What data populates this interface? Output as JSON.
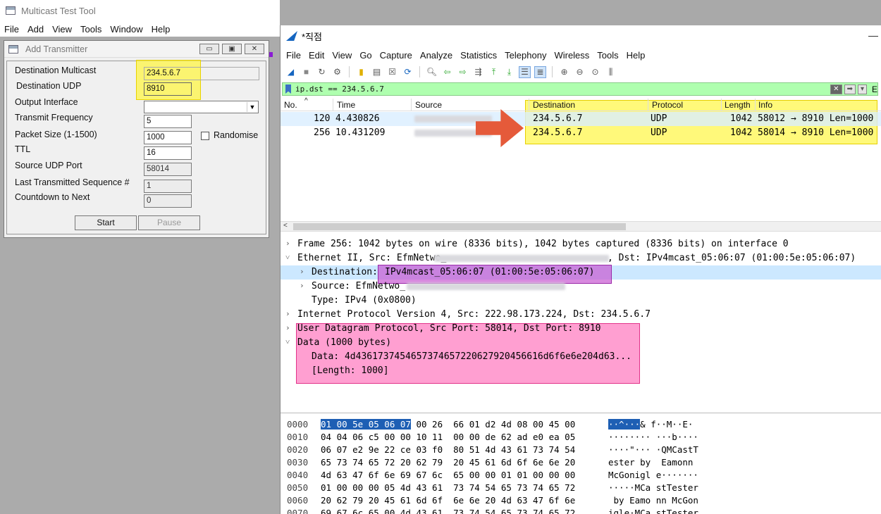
{
  "mtt": {
    "title": "Multicast Test Tool",
    "menu": [
      "File",
      "Add",
      "View",
      "Tools",
      "Window",
      "Help"
    ]
  },
  "tx": {
    "title": "Add Transmitter",
    "fields": {
      "dest_multicast": {
        "label": "Destination Multicast",
        "value": "234.5.6.7"
      },
      "dest_udp": {
        "label": "Destination UDP",
        "value": "8910"
      },
      "output_iface": {
        "label": "Output Interface",
        "value": ""
      },
      "tx_freq": {
        "label": "Transmit Frequency",
        "value": "5"
      },
      "packet_size": {
        "label": "Packet Size (1-1500)",
        "value": "1000"
      },
      "ttl": {
        "label": "TTL",
        "value": "16"
      },
      "src_udp_port": {
        "label": "Source UDP Port",
        "value": "58014"
      },
      "last_seq": {
        "label": "Last Transmitted Sequence #",
        "value": "1"
      },
      "countdown": {
        "label": "Countdown to Next",
        "value": "0"
      }
    },
    "randomise_label": "Randomise",
    "start_label": "Start",
    "pause_label": "Pause"
  },
  "ws": {
    "title": "*직점",
    "menu": [
      "File",
      "Edit",
      "View",
      "Go",
      "Capture",
      "Analyze",
      "Statistics",
      "Telephony",
      "Wireless",
      "Tools",
      "Help"
    ],
    "filter": "ip.dst == 234.5.6.7",
    "filter_right": "E",
    "columns": [
      "No.",
      "Time",
      "Source",
      "Destination",
      "Protocol",
      "Length",
      "Info"
    ],
    "packets": [
      {
        "no": "120",
        "time": "4.430826",
        "dst": "234.5.6.7",
        "proto": "UDP",
        "len": "1042",
        "info": "58012 → 8910 Len=1000"
      },
      {
        "no": "256",
        "time": "10.431209",
        "dst": "234.5.6.7",
        "proto": "UDP",
        "len": "1042",
        "info": "58014 → 8910 Len=1000"
      }
    ],
    "details": {
      "frame": "Frame 256: 1042 bytes on wire (8336 bits), 1042 bytes captured (8336 bits) on interface 0",
      "eth_a": "Ethernet II, Src: EfmNetwo_",
      "eth_b": ", Dst: IPv4mcast_05:06:07 (01:00:5e:05:06:07)",
      "dst_label": "Destination: ",
      "dst_value": "IPv4mcast_05:06:07 (01:00:5e:05:06:07)",
      "src": "Source: EfmNetwo_",
      "type": "Type: IPv4 (0x0800)",
      "ip": "Internet Protocol Version 4, Src: 222.98.173.224, Dst: 234.5.6.7",
      "udp": "User Datagram Protocol, Src Port: 58014, Dst Port: 8910",
      "data": "Data (1000 bytes)",
      "data_hex": "Data: 4d4361737454657374657220627920456616d6f6e6e204d63...",
      "data_len": "[Length: 1000]"
    },
    "hex": [
      {
        "off": "0000",
        "sel": "01 00 5e 05 06 07",
        "bytes": " 00 26  66 01 d2 4d 08 00 45 00",
        "ascii_sel": "··^···",
        "ascii": "& f··M··E·"
      },
      {
        "off": "0010",
        "sel": "",
        "bytes": "04 04 06 c5 00 00 10 11  00 00 de 62 ad e0 ea 05",
        "ascii_sel": "",
        "ascii": "········ ···b····"
      },
      {
        "off": "0020",
        "sel": "",
        "bytes": "06 07 e2 9e 22 ce 03 f0  80 51 4d 43 61 73 74 54",
        "ascii_sel": "",
        "ascii": "····\"··· ·QMCastT"
      },
      {
        "off": "0030",
        "sel": "",
        "bytes": "65 73 74 65 72 20 62 79  20 45 61 6d 6f 6e 6e 20",
        "ascii_sel": "",
        "ascii": "ester by  Eamonn"
      },
      {
        "off": "0040",
        "sel": "",
        "bytes": "4d 63 47 6f 6e 69 67 6c  65 00 00 01 01 00 00 00",
        "ascii_sel": "",
        "ascii": "McGonigl e·······"
      },
      {
        "off": "0050",
        "sel": "",
        "bytes": "01 00 00 00 05 4d 43 61  73 74 54 65 73 74 65 72",
        "ascii_sel": "",
        "ascii": "·····MCa stTester"
      },
      {
        "off": "0060",
        "sel": "",
        "bytes": "20 62 79 20 45 61 6d 6f  6e 6e 20 4d 63 47 6f 6e",
        "ascii_sel": "",
        "ascii": " by Eamo nn McGon"
      },
      {
        "off": "0070",
        "sel": "",
        "bytes": "69 67 6c 65 00 4d 43 61  73 74 54 65 73 74 65 72",
        "ascii_sel": "",
        "ascii": "igle·MCa stTester"
      }
    ]
  }
}
